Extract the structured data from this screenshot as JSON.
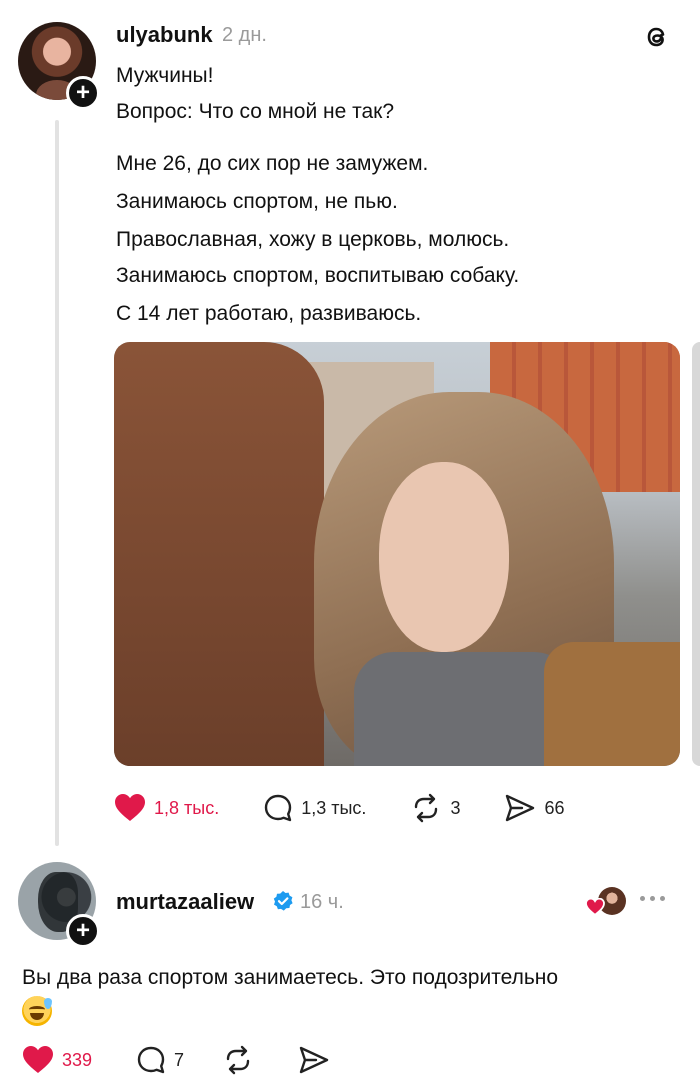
{
  "post": {
    "username": "ulyabunk",
    "time": "2 дн.",
    "lines": [
      "Мужчины!",
      "Вопрос: Что со мной не так?",
      "Мне 26, до сих пор не замужем.",
      "Занимаюсь спортом, не пью.",
      "Православная, хожу в церковь, молюсь.",
      "Занимаюсь спортом, воспитываю собаку.",
      "С 14 лет работаю, развиваюсь."
    ],
    "stats": {
      "likes": "1,8 тыс.",
      "comments": "1,3 тыс.",
      "reposts": "3",
      "shares": "66"
    },
    "like_color": "#e0194a"
  },
  "reply": {
    "username": "murtazaaliew",
    "time": "16 ч.",
    "text": "Вы два раза спортом занимаетесь. Это подозрительно",
    "emoji": "grinning-sweat-emoji",
    "stats": {
      "likes": "339",
      "comments": "7"
    }
  }
}
